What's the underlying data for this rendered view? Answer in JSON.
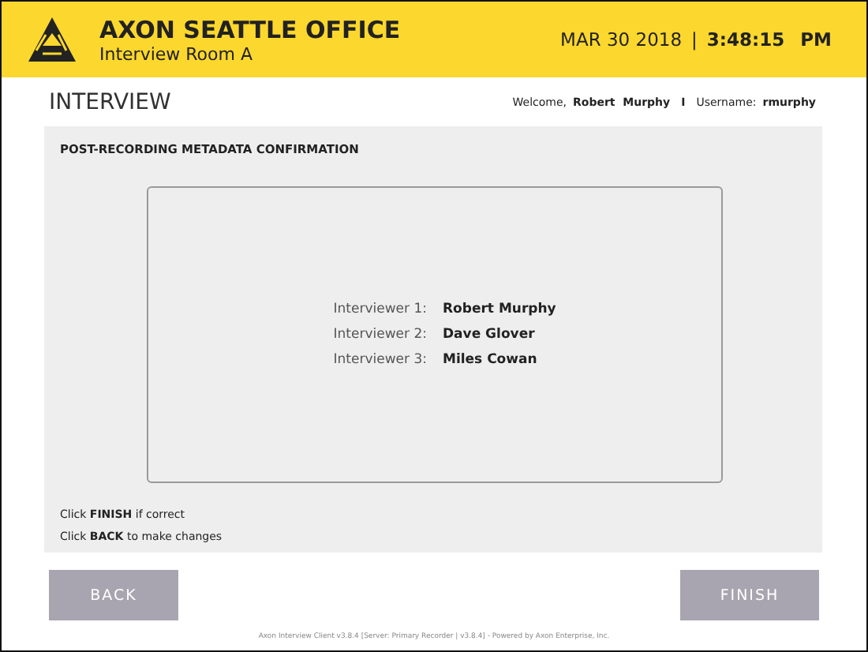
{
  "header": {
    "office": "AXON SEATTLE OFFICE",
    "room": "Interview Room A",
    "date": "MAR 30 2018",
    "separator": "|",
    "time": "3:48:15",
    "meridiem": "PM"
  },
  "title": "INTERVIEW",
  "user": {
    "welcome_label": "Welcome,",
    "name": "Robert  Murphy",
    "separator": "I",
    "username_label": "Username:",
    "username": "rmurphy"
  },
  "panel": {
    "heading": "POST-RECORDING METADATA CONFIRMATION",
    "interviewers": [
      {
        "label": "Interviewer 1:",
        "name": "Robert Murphy"
      },
      {
        "label": "Interviewer 2:",
        "name": "Dave Glover"
      },
      {
        "label": "Interviewer 3:",
        "name": "Miles Cowan"
      }
    ],
    "instructions": [
      "Click **FINISH** if correct",
      "Click **BACK** to make changes"
    ]
  },
  "buttons": [
    {
      "label": "BACK",
      "disabled": true
    },
    {
      "label": "FINISH",
      "disabled": true
    }
  ],
  "footer": "Axon Interview Client v3.8.4 [Server: Primary Recorder | v3.8.4] - Powered by Axon Enterprise, Inc."
}
